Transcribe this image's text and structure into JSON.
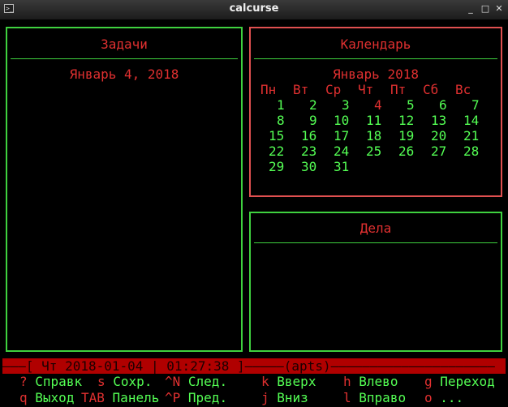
{
  "window": {
    "title": "calcurse"
  },
  "panels": {
    "tasks": {
      "title": "Задачи",
      "date": "Январь 4, 2018"
    },
    "calendar": {
      "title": "Календарь",
      "month": "Январь 2018",
      "weekdays": [
        "Пн",
        "Вт",
        "Ср",
        "Чт",
        "Пт",
        "Сб",
        "Вс"
      ],
      "weeks": [
        [
          "",
          "",
          "",
          "",
          "",
          "",
          ""
        ],
        [
          "1",
          "2",
          "3",
          "4",
          "5",
          "6",
          "7"
        ],
        [
          "8",
          "9",
          "10",
          "11",
          "12",
          "13",
          "14"
        ],
        [
          "15",
          "16",
          "17",
          "18",
          "19",
          "20",
          "21"
        ],
        [
          "22",
          "23",
          "24",
          "25",
          "26",
          "27",
          "28"
        ],
        [
          "29",
          "30",
          "31",
          "",
          "",
          "",
          ""
        ]
      ],
      "today": "4"
    },
    "todo": {
      "title": "Дела"
    }
  },
  "status": {
    "text": "———[ Чт 2018-01-04 | 01:27:38 ]—————(apts)—————————————————————"
  },
  "help": {
    "row1": [
      {
        "key": "?",
        "label": "Справк"
      },
      {
        "key": "s",
        "label": "Сохр."
      },
      {
        "key": "^N",
        "label": "След."
      },
      {
        "key": "k",
        "label": "Вверх"
      },
      {
        "key": "h",
        "label": "Влево"
      },
      {
        "key": "g",
        "label": "Переход"
      }
    ],
    "row2": [
      {
        "key": "q",
        "label": "Выход"
      },
      {
        "key": "TAB",
        "label": "Панель"
      },
      {
        "key": "^P",
        "label": "Пред."
      },
      {
        "key": "j",
        "label": "Вниз"
      },
      {
        "key": "l",
        "label": "Вправо"
      },
      {
        "key": "o",
        "label": "..."
      }
    ]
  }
}
